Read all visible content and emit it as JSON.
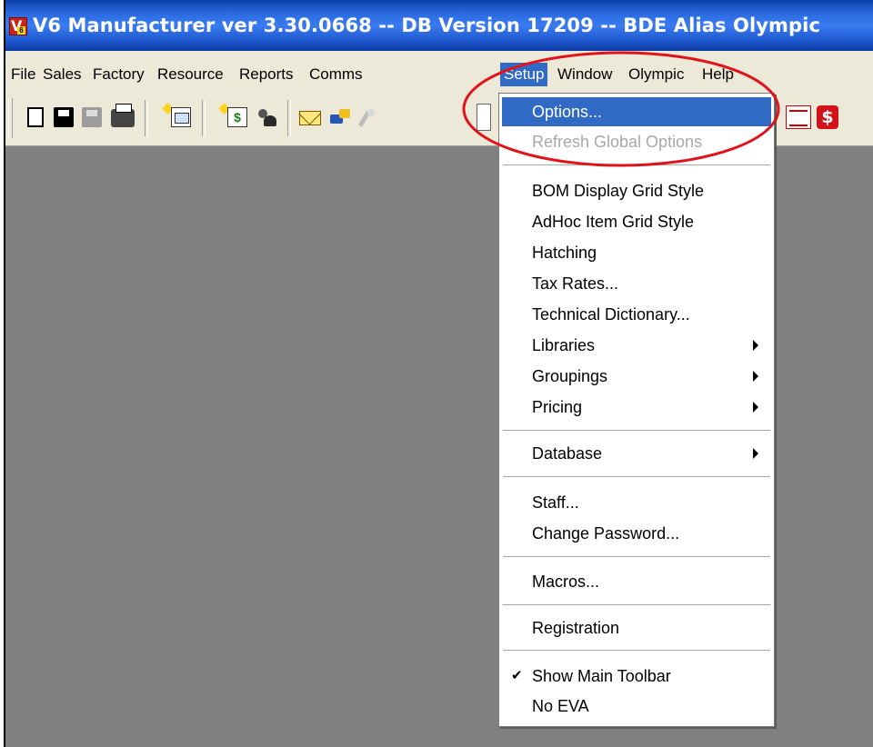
{
  "window": {
    "title": "V6 Manufacturer ver 3.30.0668 -- DB Version 17209 -- BDE Alias Olympic",
    "icon_letter": "V",
    "icon_badge": "6"
  },
  "menubar": {
    "items": [
      {
        "label": "File"
      },
      {
        "label": "Sales"
      },
      {
        "label": "Factory"
      },
      {
        "label": "Resource"
      },
      {
        "label": "Reports"
      },
      {
        "label": "Comms"
      },
      {
        "label": "Setup"
      },
      {
        "label": "Window"
      },
      {
        "label": "Olympic"
      },
      {
        "label": "Help"
      }
    ],
    "active": "Setup"
  },
  "toolbar": {
    "icons": [
      "new-document-icon",
      "save-icon",
      "save-all-icon",
      "print-icon",
      "new-item-icon",
      "new-quote-icon",
      "staff-icon",
      "email-icon",
      "transfer-icon",
      "wand-icon",
      "part-icon",
      "report-icon",
      "dollar-icon"
    ],
    "dollar_glyph": "$"
  },
  "setup_menu": {
    "items": [
      {
        "label": "Options...",
        "state": "selected"
      },
      {
        "label": "Refresh Global Options",
        "state": "disabled"
      },
      {
        "label": "BOM Display Grid Style"
      },
      {
        "label": "AdHoc Item Grid Style"
      },
      {
        "label": "Hatching"
      },
      {
        "label": "Tax Rates..."
      },
      {
        "label": "Technical Dictionary..."
      },
      {
        "label": "Libraries",
        "submenu": true
      },
      {
        "label": "Groupings",
        "submenu": true
      },
      {
        "label": "Pricing",
        "submenu": true
      },
      {
        "label": "Database",
        "submenu": true
      },
      {
        "label": "Staff..."
      },
      {
        "label": "Change Password..."
      },
      {
        "label": "Macros..."
      },
      {
        "label": "Registration"
      },
      {
        "label": "Show Main Toolbar",
        "checked": true
      },
      {
        "label": "No EVA"
      }
    ],
    "check_glyph": "✔"
  },
  "annotation": {
    "color": "#e0121a"
  },
  "colors": {
    "highlight": "#316ac5",
    "workspace": "#808080",
    "menubar": "#ece9d8"
  }
}
